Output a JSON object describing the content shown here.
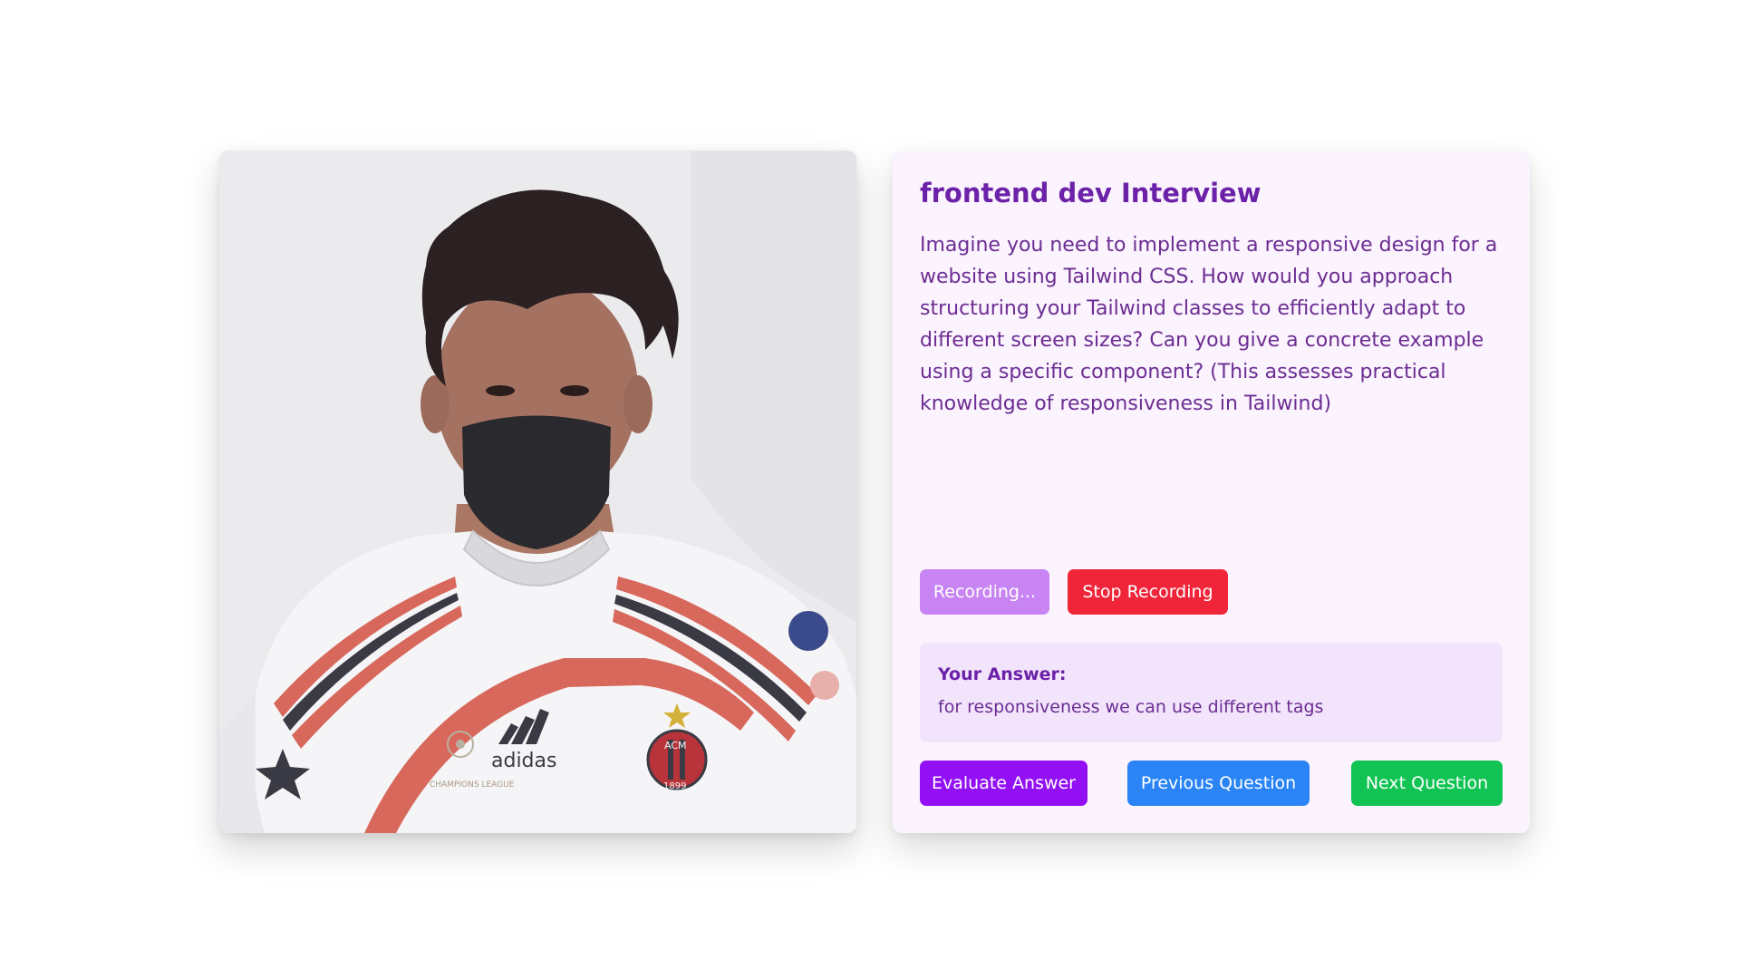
{
  "webcam": {
    "jersey_brand": "adidas",
    "jersey_badge": "ACM",
    "badge_year": "1899",
    "sleeve_text": "CHAMPIONS LEAGUE"
  },
  "interview": {
    "title": "frontend dev Interview",
    "question": "Imagine you need to implement a responsive design for a website using Tailwind CSS. How would you approach structuring your Tailwind classes to efficiently adapt to different screen sizes? Can you give a concrete example using a specific component? (This assesses practical knowledge of responsiveness in Tailwind)"
  },
  "recording": {
    "recording_label": "Recording...",
    "stop_label": "Stop Recording"
  },
  "answer": {
    "label": "Your Answer:",
    "text": "for responsiveness we can use different tags"
  },
  "navigation": {
    "evaluate_label": "Evaluate Answer",
    "previous_label": "Previous Question",
    "next_label": "Next Question"
  },
  "colors": {
    "title": "#6b21a8",
    "panel_bg": "#fbf3fd",
    "answer_bg": "#f2e4fb",
    "recording_btn": "#c784f2",
    "stop_btn": "#f0253a",
    "evaluate_btn": "#9310f5",
    "previous_btn": "#2a84f5",
    "next_btn": "#10c353"
  }
}
